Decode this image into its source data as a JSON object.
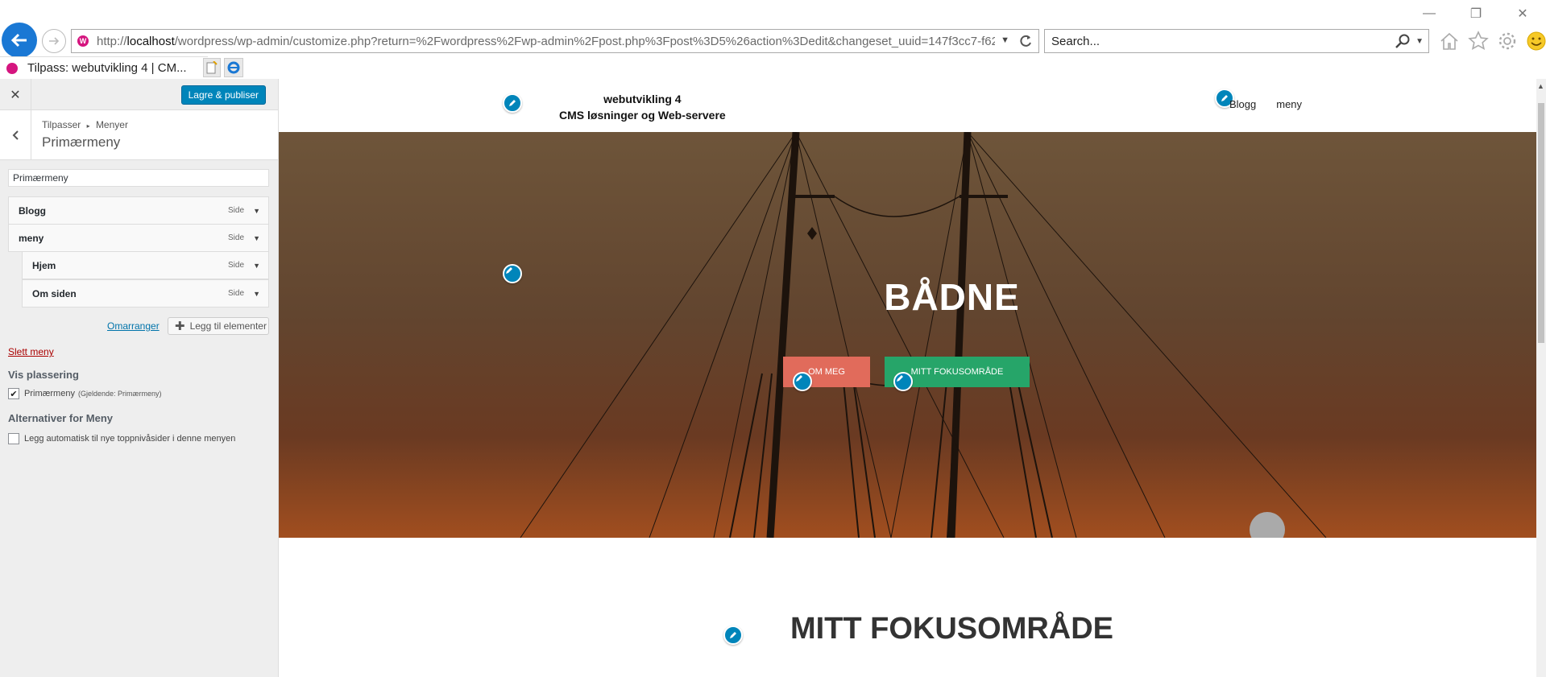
{
  "browser": {
    "url_prefix": "http://",
    "url_host": "localhost",
    "url_rest": "/wordpress/wp-admin/customize.php?return=%2Fwordpress%2Fwp-admin%2Fpost.php%3Fpost%3D5%26action%3Dedit&changeset_uuid=147f3cc7-f62",
    "search_placeholder": "Search...",
    "tab_title": "Tilpass: webutvikling 4 | CM...",
    "icons": [
      "back-arrow-icon",
      "forward-arrow-icon",
      "refresh-icon",
      "search-icon",
      "home-icon",
      "star-icon",
      "gear-icon",
      "smiley-icon"
    ]
  },
  "customizer": {
    "close_label": "✕",
    "publish_label": "Lagre & publiser",
    "breadcrumb_parent": "Tilpasser",
    "breadcrumb_sep": "▸",
    "breadcrumb_child": "Menyer",
    "section_title": "Primærmeny",
    "menu_name_value": "Primærmeny",
    "menu_items": [
      {
        "label": "Blogg",
        "type": "Side",
        "depth": 0
      },
      {
        "label": "meny",
        "type": "Side",
        "depth": 0
      },
      {
        "label": "Hjem",
        "type": "Side",
        "depth": 1
      },
      {
        "label": "Om siden",
        "type": "Side",
        "depth": 1
      }
    ],
    "reorder_label": "Omarranger",
    "add_items_label": "Legg til elementer",
    "delete_menu_label": "Slett meny",
    "location_heading": "Vis plassering",
    "location_checkbox_label": "Primærmeny",
    "location_checkbox_note": "(Gjeldende: Primærmeny)",
    "location_checked": true,
    "options_heading": "Alternativer for Meny",
    "auto_add_label": "Legg automatisk til nye toppnivåsider i denne menyen",
    "auto_add_checked": false
  },
  "preview": {
    "site_title": "webutvikling 4",
    "site_tagline": "CMS løsninger og Web-servere",
    "nav": [
      "Blogg",
      "meny"
    ],
    "hero_title": "BÅDNE",
    "btn_om": "OM MEG",
    "btn_fokus": "MITT FOKUSOMRÅDE",
    "section_title": "MITT FOKUSOMRÅDE",
    "accent_blue": "#0085ba",
    "btn_om_color": "#e16b5b",
    "btn_fokus_color": "#26a569"
  }
}
